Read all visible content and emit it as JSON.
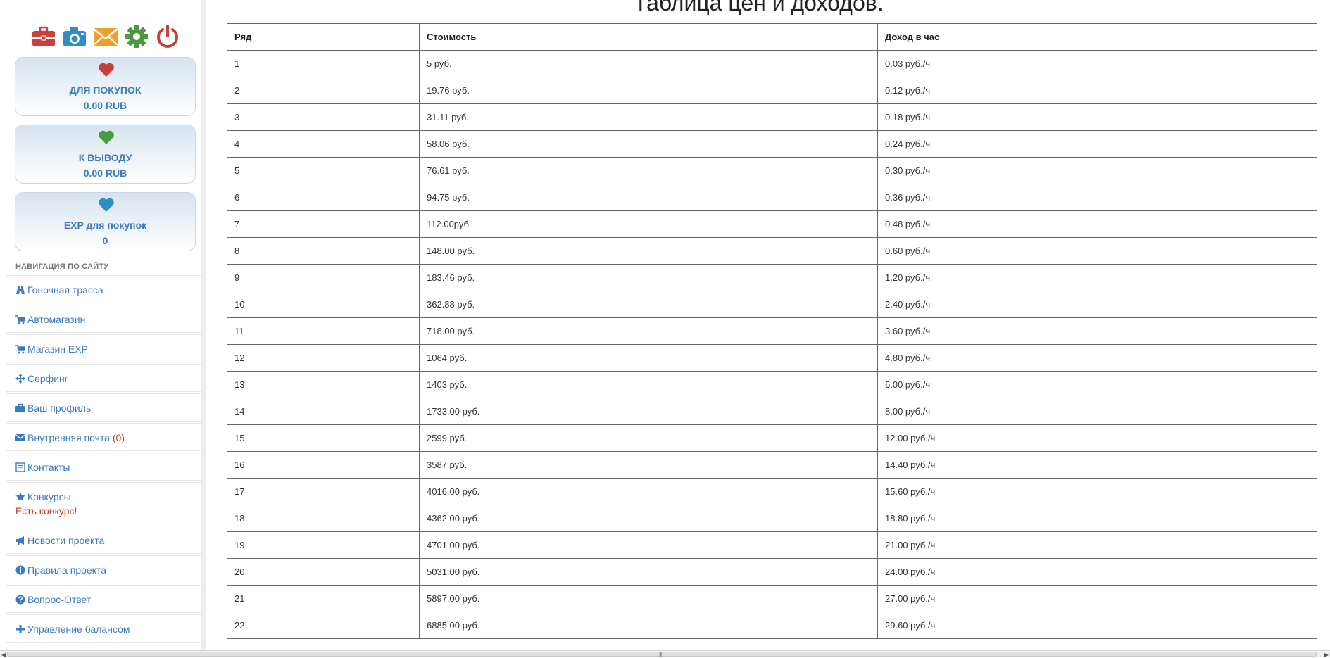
{
  "sidebar": {
    "top_icons": [
      "briefcase-icon",
      "camera-icon",
      "envelope-icon",
      "gear-icon",
      "power-icon"
    ],
    "balances": [
      {
        "label": "ДЛЯ ПОКУПОК",
        "value": "0.00 RUB",
        "heart_color": "#c9403a"
      },
      {
        "label": "К ВЫВОДУ",
        "value": "0.00 RUB",
        "heart_color": "#4a9a3f"
      },
      {
        "label": "EXP для покупок",
        "value": "0",
        "heart_color": "#2f8fc4"
      }
    ],
    "nav_heading": "НАВИГАЦИЯ ПО САЙТУ",
    "nav": [
      {
        "label": "Гоночная трасса",
        "icon": "road-icon"
      },
      {
        "label": "Автомагазин",
        "icon": "cart-icon"
      },
      {
        "label": "Магазин EXP",
        "icon": "cart-icon"
      },
      {
        "label": "Серфинг",
        "icon": "move-icon"
      },
      {
        "label": "Ваш профиль",
        "icon": "briefcase-icon"
      },
      {
        "label": "Внутренняя почта",
        "count": "(0)",
        "icon": "envelope-icon"
      },
      {
        "label": "Контакты",
        "icon": "list-icon"
      },
      {
        "label": "Конкурсы",
        "sub": "Есть конкурс!",
        "icon": "star-icon"
      },
      {
        "label": "Новости проекта",
        "icon": "bullhorn-icon"
      },
      {
        "label": "Правила проекта",
        "icon": "info-icon"
      },
      {
        "label": "Вопрос-Ответ",
        "icon": "question-icon"
      },
      {
        "label": "Управление балансом",
        "icon": "plus-icon"
      }
    ]
  },
  "main": {
    "title": "Таблица цен и доходов.",
    "table": {
      "headers": [
        "Ряд",
        "Стоимость",
        "Доход в час"
      ],
      "rows": [
        [
          "1",
          "5 руб.",
          "0.03 руб./ч"
        ],
        [
          "2",
          "19.76 руб.",
          "0.12 руб./ч"
        ],
        [
          "3",
          "31.11 руб.",
          "0.18 руб./ч"
        ],
        [
          "4",
          "58.06 руб.",
          "0.24 руб./ч"
        ],
        [
          "5",
          "76.61 руб.",
          "0.30 руб./ч"
        ],
        [
          "6",
          "94.75 руб.",
          "0.36 руб./ч"
        ],
        [
          "7",
          "112.00руб.",
          "0.48 руб./ч"
        ],
        [
          "8",
          "148.00 руб.",
          "0.60 руб./ч"
        ],
        [
          "9",
          "183.46 руб.",
          "1.20 руб./ч"
        ],
        [
          "10",
          "362.88 руб.",
          "2.40 руб./ч"
        ],
        [
          "11",
          "718.00 руб.",
          "3.60 руб./ч"
        ],
        [
          "12",
          "1064 руб.",
          "4.80 руб./ч"
        ],
        [
          "13",
          "1403 руб.",
          "6.00 руб./ч"
        ],
        [
          "14",
          "1733.00 руб.",
          "8.00 руб./ч"
        ],
        [
          "15",
          "2599 руб.",
          "12.00 руб./ч"
        ],
        [
          "16",
          "3587 руб.",
          "14.40 руб./ч"
        ],
        [
          "17",
          "4016.00 руб.",
          "15.60 руб./ч"
        ],
        [
          "18",
          "4362.00 руб.",
          "18.80 руб./ч"
        ],
        [
          "19",
          "4701.00 руб.",
          "21.00 руб./ч"
        ],
        [
          "20",
          "5031.00 руб.",
          "24.00 руб./ч"
        ],
        [
          "21",
          "5897.00 руб.",
          "27.00 руб./ч"
        ],
        [
          "22",
          "6885.00 руб.",
          "29.60 руб./ч"
        ]
      ]
    }
  }
}
